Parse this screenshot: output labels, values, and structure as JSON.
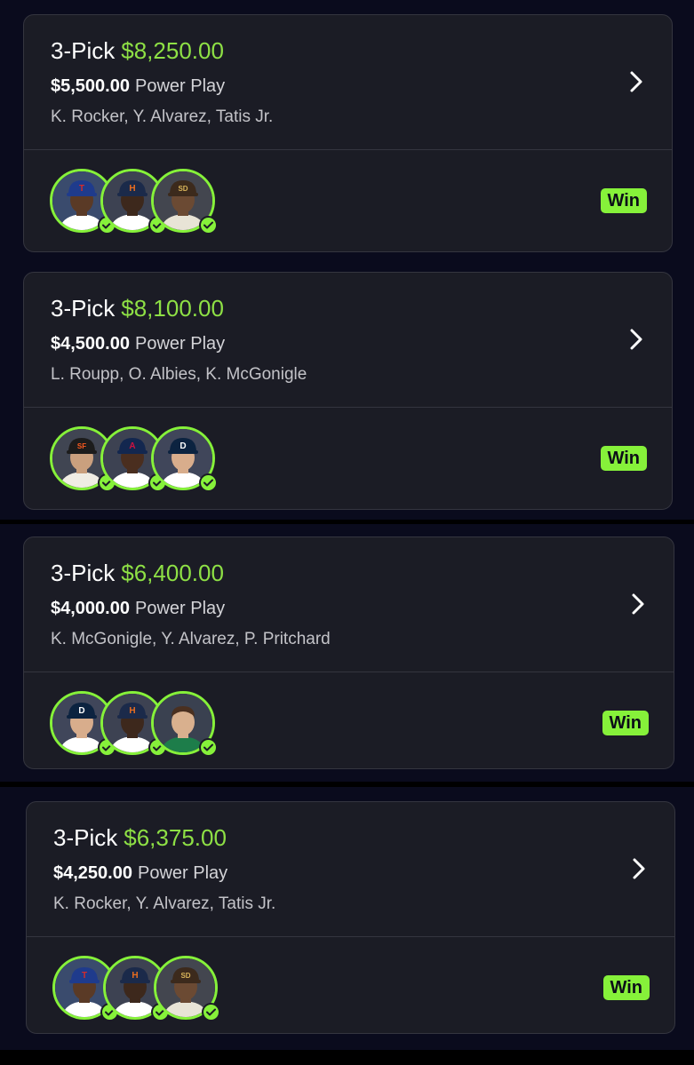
{
  "cards": [
    {
      "pick_label": "3-Pick",
      "payout": "$8,250.00",
      "entry": "$5,500.00",
      "play_type": "Power Play",
      "players": "K. Rocker, Y. Alvarez, Tatis Jr.",
      "status": "Win",
      "avatars": [
        {
          "name": "K. Rocker",
          "team_letter": "T",
          "cap_color": "#1f3b8c",
          "letter_color": "#d52b2b",
          "skin": "#5a3a26",
          "jersey": "#ffffff",
          "backdrop": "#3a4b6d"
        },
        {
          "name": "Y. Alvarez",
          "team_letter": "H",
          "cap_color": "#1b2a4a",
          "letter_color": "#eb6e1f",
          "skin": "#3d281c",
          "jersey": "#ffffff",
          "backdrop": "#3d4252"
        },
        {
          "name": "Tatis Jr.",
          "team_letter": "SD",
          "cap_color": "#3c2a1c",
          "letter_color": "#d8b45a",
          "skin": "#6b4a33",
          "jersey": "#e8e4d6",
          "backdrop": "#43464f"
        }
      ]
    },
    {
      "pick_label": "3-Pick",
      "payout": "$8,100.00",
      "entry": "$4,500.00",
      "play_type": "Power Play",
      "players": "L. Roupp, O. Albies, K. McGonigle",
      "status": "Win",
      "avatars": [
        {
          "name": "L. Roupp",
          "team_letter": "SF",
          "cap_color": "#1c1c1c",
          "letter_color": "#fd5a1e",
          "skin": "#caa07e",
          "jersey": "#f0ede4",
          "backdrop": "#404552"
        },
        {
          "name": "O. Albies",
          "team_letter": "A",
          "cap_color": "#13274f",
          "letter_color": "#ce1141",
          "skin": "#4a2e1f",
          "jersey": "#ffffff",
          "backdrop": "#3d4252"
        },
        {
          "name": "K. McGonigle",
          "team_letter": "D",
          "cap_color": "#0c2340",
          "letter_color": "#ffffff",
          "skin": "#d8ad8c",
          "jersey": "#ffffff",
          "backdrop": "#40465a"
        }
      ]
    },
    {
      "pick_label": "3-Pick",
      "payout": "$6,400.00",
      "entry": "$4,000.00",
      "play_type": "Power Play",
      "players": "K. McGonigle, Y. Alvarez, P. Pritchard",
      "status": "Win",
      "avatars": [
        {
          "name": "K. McGonigle",
          "team_letter": "D",
          "cap_color": "#0c2340",
          "letter_color": "#ffffff",
          "skin": "#d8ad8c",
          "jersey": "#ffffff",
          "backdrop": "#40465a"
        },
        {
          "name": "Y. Alvarez",
          "team_letter": "H",
          "cap_color": "#1b2a4a",
          "letter_color": "#eb6e1f",
          "skin": "#3d281c",
          "jersey": "#ffffff",
          "backdrop": "#3d4252"
        },
        {
          "name": "P. Pritchard",
          "team_letter": "",
          "cap_color": "",
          "letter_color": "",
          "skin": "#d9b08e",
          "jersey": "#1d7d4a",
          "backdrop": "#3a4150",
          "hair": "#4a3020"
        }
      ]
    },
    {
      "pick_label": "3-Pick",
      "payout": "$6,375.00",
      "entry": "$4,250.00",
      "play_type": "Power Play",
      "players": "K. Rocker, Y. Alvarez, Tatis Jr.",
      "status": "Win",
      "avatars": [
        {
          "name": "K. Rocker",
          "team_letter": "T",
          "cap_color": "#1f3b8c",
          "letter_color": "#d52b2b",
          "skin": "#5a3a26",
          "jersey": "#ffffff",
          "backdrop": "#3a4b6d"
        },
        {
          "name": "Y. Alvarez",
          "team_letter": "H",
          "cap_color": "#1b2a4a",
          "letter_color": "#eb6e1f",
          "skin": "#3d281c",
          "jersey": "#ffffff",
          "backdrop": "#3d4252"
        },
        {
          "name": "Tatis Jr.",
          "team_letter": "SD",
          "cap_color": "#3c2a1c",
          "letter_color": "#d8b45a",
          "skin": "#6b4a33",
          "jersey": "#e8e4d6",
          "backdrop": "#43464f"
        }
      ]
    }
  ],
  "colors": {
    "accent": "#86f13a",
    "payout_text": "#8ee045",
    "card_bg": "#1b1c25",
    "card_border": "#34353f",
    "page_bg": "#0a0b1d"
  },
  "icons": {
    "chevron": "chevron-right-icon",
    "check": "check-icon"
  }
}
